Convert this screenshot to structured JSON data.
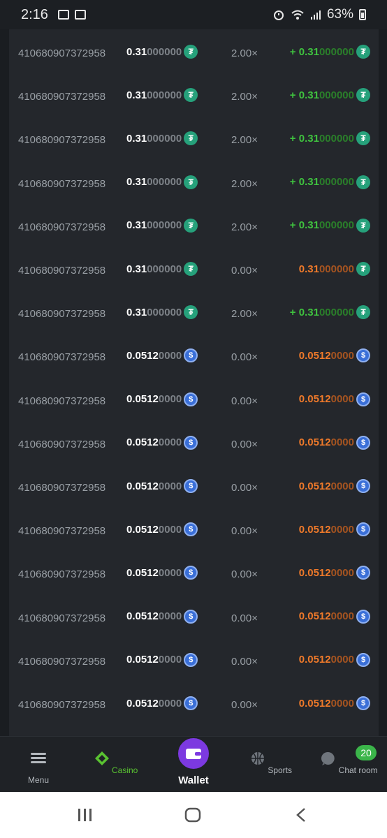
{
  "status_bar": {
    "time": "2:16",
    "battery": "63%"
  },
  "rows": [
    {
      "id": "410680907372958",
      "amount_main": "0.31",
      "amount_tail": "000000",
      "coin": "usdt",
      "mult": "2.00×",
      "payout_sign": "+ ",
      "payout_main": "0.31",
      "payout_tail": "000000",
      "win": true
    },
    {
      "id": "410680907372958",
      "amount_main": "0.31",
      "amount_tail": "000000",
      "coin": "usdt",
      "mult": "2.00×",
      "payout_sign": "+ ",
      "payout_main": "0.31",
      "payout_tail": "000000",
      "win": true
    },
    {
      "id": "410680907372958",
      "amount_main": "0.31",
      "amount_tail": "000000",
      "coin": "usdt",
      "mult": "2.00×",
      "payout_sign": "+ ",
      "payout_main": "0.31",
      "payout_tail": "000000",
      "win": true
    },
    {
      "id": "410680907372958",
      "amount_main": "0.31",
      "amount_tail": "000000",
      "coin": "usdt",
      "mult": "2.00×",
      "payout_sign": "+ ",
      "payout_main": "0.31",
      "payout_tail": "000000",
      "win": true
    },
    {
      "id": "410680907372958",
      "amount_main": "0.31",
      "amount_tail": "000000",
      "coin": "usdt",
      "mult": "2.00×",
      "payout_sign": "+ ",
      "payout_main": "0.31",
      "payout_tail": "000000",
      "win": true
    },
    {
      "id": "410680907372958",
      "amount_main": "0.31",
      "amount_tail": "000000",
      "coin": "usdt",
      "mult": "0.00×",
      "payout_sign": "",
      "payout_main": "0.31",
      "payout_tail": "000000",
      "win": false
    },
    {
      "id": "410680907372958",
      "amount_main": "0.31",
      "amount_tail": "000000",
      "coin": "usdt",
      "mult": "2.00×",
      "payout_sign": "+ ",
      "payout_main": "0.31",
      "payout_tail": "000000",
      "win": true
    },
    {
      "id": "410680907372958",
      "amount_main": "0.0512",
      "amount_tail": "0000",
      "coin": "usdc",
      "mult": "0.00×",
      "payout_sign": "",
      "payout_main": "0.0512",
      "payout_tail": "0000",
      "win": false
    },
    {
      "id": "410680907372958",
      "amount_main": "0.0512",
      "amount_tail": "0000",
      "coin": "usdc",
      "mult": "0.00×",
      "payout_sign": "",
      "payout_main": "0.0512",
      "payout_tail": "0000",
      "win": false
    },
    {
      "id": "410680907372958",
      "amount_main": "0.0512",
      "amount_tail": "0000",
      "coin": "usdc",
      "mult": "0.00×",
      "payout_sign": "",
      "payout_main": "0.0512",
      "payout_tail": "0000",
      "win": false
    },
    {
      "id": "410680907372958",
      "amount_main": "0.0512",
      "amount_tail": "0000",
      "coin": "usdc",
      "mult": "0.00×",
      "payout_sign": "",
      "payout_main": "0.0512",
      "payout_tail": "0000",
      "win": false
    },
    {
      "id": "410680907372958",
      "amount_main": "0.0512",
      "amount_tail": "0000",
      "coin": "usdc",
      "mult": "0.00×",
      "payout_sign": "",
      "payout_main": "0.0512",
      "payout_tail": "0000",
      "win": false
    },
    {
      "id": "410680907372958",
      "amount_main": "0.0512",
      "amount_tail": "0000",
      "coin": "usdc",
      "mult": "0.00×",
      "payout_sign": "",
      "payout_main": "0.0512",
      "payout_tail": "0000",
      "win": false
    },
    {
      "id": "410680907372958",
      "amount_main": "0.0512",
      "amount_tail": "0000",
      "coin": "usdc",
      "mult": "0.00×",
      "payout_sign": "",
      "payout_main": "0.0512",
      "payout_tail": "0000",
      "win": false
    },
    {
      "id": "410680907372958",
      "amount_main": "0.0512",
      "amount_tail": "0000",
      "coin": "usdc",
      "mult": "0.00×",
      "payout_sign": "",
      "payout_main": "0.0512",
      "payout_tail": "0000",
      "win": false
    },
    {
      "id": "410680907372958",
      "amount_main": "0.0512",
      "amount_tail": "0000",
      "coin": "usdc",
      "mult": "0.00×",
      "payout_sign": "",
      "payout_main": "0.0512",
      "payout_tail": "0000",
      "win": false
    }
  ],
  "coins": {
    "usdt": {
      "icon": "tether-icon",
      "glyph": "₮",
      "color": "#26a17b"
    },
    "usdc": {
      "icon": "usd-coin-icon",
      "glyph": "$",
      "color": "#3a6fd8"
    }
  },
  "bottom_nav": {
    "menu": "Menu",
    "casino": "Casino",
    "wallet": "Wallet",
    "sports": "Sports",
    "chat": "Chat room",
    "chat_badge": "20",
    "active_color": "#59c231"
  }
}
